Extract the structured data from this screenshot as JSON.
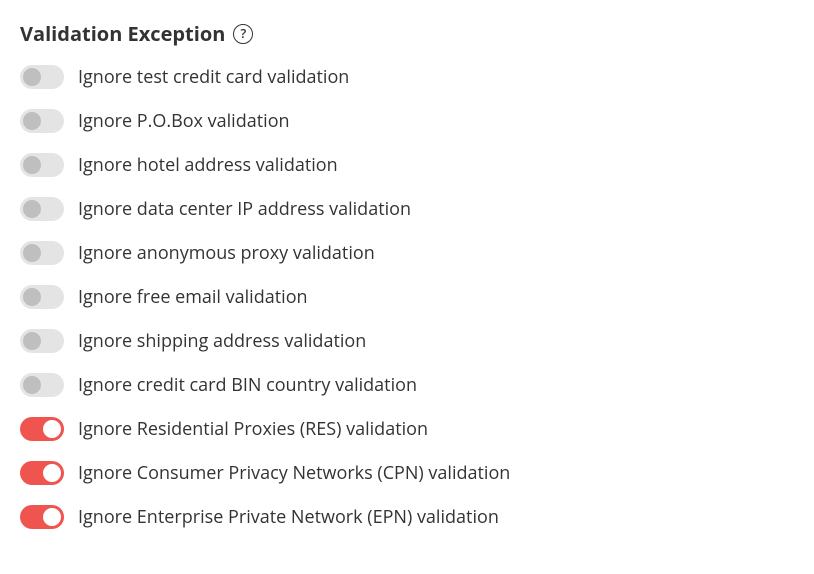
{
  "section": {
    "title": "Validation Exception"
  },
  "toggles": [
    {
      "label": "Ignore test credit card validation",
      "checked": false
    },
    {
      "label": "Ignore P.O.Box validation",
      "checked": false
    },
    {
      "label": "Ignore hotel address validation",
      "checked": false
    },
    {
      "label": "Ignore data center IP address validation",
      "checked": false
    },
    {
      "label": "Ignore anonymous proxy validation",
      "checked": false
    },
    {
      "label": "Ignore free email validation",
      "checked": false
    },
    {
      "label": "Ignore shipping address validation",
      "checked": false
    },
    {
      "label": "Ignore credit card BIN country validation",
      "checked": false
    },
    {
      "label": "Ignore Residential Proxies (RES) validation",
      "checked": true
    },
    {
      "label": "Ignore Consumer Privacy Networks (CPN) validation",
      "checked": true
    },
    {
      "label": "Ignore Enterprise Private Network (EPN) validation",
      "checked": true
    }
  ]
}
